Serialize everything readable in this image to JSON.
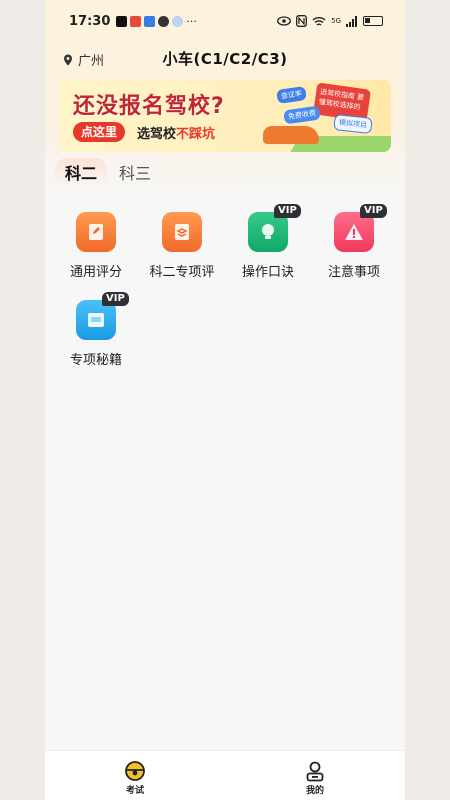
{
  "status_bar": {
    "time": "17:30",
    "network": "5G",
    "icons": [
      "tiktok-icon",
      "app-icon",
      "mail-icon",
      "app-icon",
      "app-icon",
      "more-dots-icon",
      "eye-icon",
      "nfc-icon",
      "wifi-icon",
      "signal-icon",
      "battery-icon"
    ],
    "more": "···"
  },
  "header": {
    "location": "广州",
    "title": "小车(C1/C2/C3)"
  },
  "banner": {
    "headline": "还没报名驾校?",
    "cta": "点这里",
    "sub_prefix": "选驾校",
    "sub_highlight": "不踩坑",
    "tags": [
      "查证率",
      "免费收费",
      "模拟项目"
    ],
    "card_text": "选驾校指南 要懂驾校选择的"
  },
  "tabs": [
    {
      "label": "科二",
      "active": true
    },
    {
      "label": "科三",
      "active": false
    }
  ],
  "grid": [
    {
      "label": "通用评分",
      "color": "#f26a2a",
      "icon": "edit-doc-icon",
      "vip": false
    },
    {
      "label": "科二专项评",
      "color": "#f26a2a",
      "icon": "layers-icon",
      "vip": false
    },
    {
      "label": "操作口诀",
      "color": "#12a86a",
      "icon": "lightbulb-icon",
      "vip": true
    },
    {
      "label": "注意事项",
      "color": "#ef3a5e",
      "icon": "warning-icon",
      "vip": true
    },
    {
      "label": "专项秘籍",
      "color": "#1b9ae6",
      "icon": "book-icon",
      "vip": true
    }
  ],
  "vip_label": "VIP",
  "bottom_nav": [
    {
      "label": "考试",
      "icon": "steering-wheel-icon",
      "active": true
    },
    {
      "label": "我的",
      "icon": "profile-icon",
      "active": false
    }
  ]
}
